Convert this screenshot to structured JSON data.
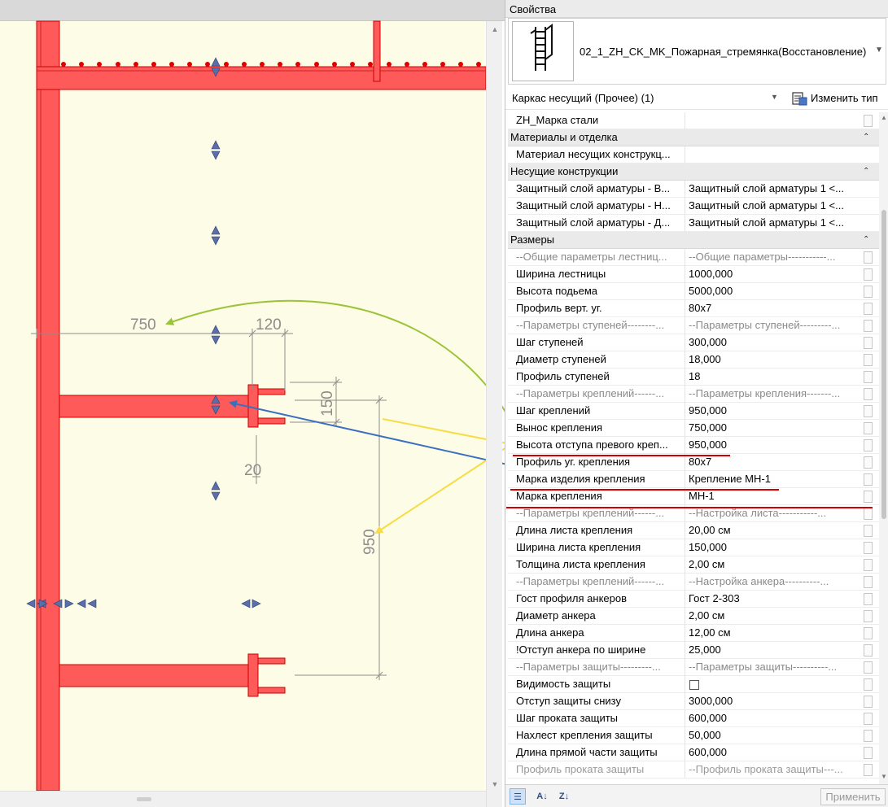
{
  "colors": {
    "canvas_bg": "#fdfce6",
    "steel_fill": "#ff5a5a",
    "steel_edge": "#cc0000",
    "grip": "#5a6ea8",
    "dimension": "#8c8c8c",
    "arrow_green": "#9bc43a",
    "arrow_blue": "#3b6fbf",
    "arrow_yellow": "#f6dc48",
    "underline_red": "#d40000"
  },
  "canvas": {
    "dims": {
      "d750": "750",
      "d120": "120",
      "d150": "150",
      "d20": "20",
      "d950": "950"
    }
  },
  "properties": {
    "header": "Свойства",
    "type_name": "02_1_ZH_CK_MK_Пожарная_стремянка(Восстановление)",
    "category": "Каркас несущий (Прочее) (1)",
    "edit_type_label": "Изменить тип",
    "apply_label": "Применить",
    "rows": [
      {
        "kind": "param",
        "name": "ZH_Марка стали",
        "value": "",
        "check": true
      },
      {
        "kind": "group",
        "name": "Материалы и отделка"
      },
      {
        "kind": "param",
        "name": "Материал несущих конструкц...",
        "value": "",
        "check": false
      },
      {
        "kind": "group",
        "name": "Несущие конструкции"
      },
      {
        "kind": "param",
        "name": "Защитный слой арматуры - В...",
        "value": "Защитный слой арматуры 1 <...",
        "check": false
      },
      {
        "kind": "param",
        "name": "Защитный слой арматуры - Н...",
        "value": "Защитный слой арматуры 1 <...",
        "check": false
      },
      {
        "kind": "param",
        "name": "Защитный слой арматуры - Д...",
        "value": "Защитный слой арматуры 1 <...",
        "check": false
      },
      {
        "kind": "group",
        "name": "Размеры"
      },
      {
        "kind": "sep",
        "name": "--Общие параметры лестниц...",
        "value": "--Общие параметры-----------...",
        "check": true
      },
      {
        "kind": "param",
        "name": "Ширина лестницы",
        "value": "1000,000",
        "check": true
      },
      {
        "kind": "param",
        "name": "Высота подьема",
        "value": "5000,000",
        "check": true
      },
      {
        "kind": "param",
        "name": "Профиль верт. уг.",
        "value": "80x7",
        "check": true
      },
      {
        "kind": "sep",
        "name": "--Параметры ступеней--------...",
        "value": "--Параметры ступеней---------...",
        "check": true
      },
      {
        "kind": "param",
        "name": "Шаг ступеней",
        "value": "300,000",
        "check": true
      },
      {
        "kind": "param",
        "name": "Диаметр ступеней",
        "value": "18,000",
        "check": true
      },
      {
        "kind": "param",
        "name": "Профиль ступеней",
        "value": "18",
        "check": true
      },
      {
        "kind": "sep",
        "name": "--Параметры креплений------...",
        "value": "--Параметры крепления-------...",
        "check": true
      },
      {
        "kind": "param",
        "name": "Шаг креплений",
        "value": "950,000",
        "check": true
      },
      {
        "kind": "param",
        "name": "Вынос крепления",
        "value": "750,000",
        "check": true
      },
      {
        "kind": "param",
        "name": "Высота отступа превого креп...",
        "value": "950,000",
        "check": true
      },
      {
        "kind": "param",
        "name": "Профиль уг. крепления",
        "value": "80x7",
        "check": true
      },
      {
        "kind": "param",
        "name": "Марка изделия крепления",
        "value": "Крепление МН-1",
        "check": true
      },
      {
        "kind": "param",
        "name": "Марка крепления",
        "value": "МН-1",
        "check": true
      },
      {
        "kind": "sep",
        "name": "--Параметры креплений------...",
        "value": "--Настройка листа-----------...",
        "check": true
      },
      {
        "kind": "param",
        "name": "Длина листа крепления",
        "value": "20,00 см",
        "check": true
      },
      {
        "kind": "param",
        "name": "Ширина листа крепления",
        "value": "150,000",
        "check": true
      },
      {
        "kind": "param",
        "name": "Толщина листа крепления",
        "value": "2,00 см",
        "check": true
      },
      {
        "kind": "sep",
        "name": "--Параметры креплений------...",
        "value": "--Настройка анкера----------...",
        "check": true
      },
      {
        "kind": "param",
        "name": "Гост профиля анкеров",
        "value": "Гост 2-303",
        "check": true
      },
      {
        "kind": "param",
        "name": "Диаметр анкера",
        "value": "2,00 см",
        "check": true
      },
      {
        "kind": "param",
        "name": "Длина анкера",
        "value": "12,00 см",
        "check": true
      },
      {
        "kind": "param",
        "name": "!Отступ анкера по ширине",
        "value": "25,000",
        "check": true
      },
      {
        "kind": "sep",
        "name": "--Параметры защиты---------...",
        "value": "--Параметры защиты----------...",
        "check": true
      },
      {
        "kind": "checkbox",
        "name": "Видимость защиты",
        "value": "",
        "check": true
      },
      {
        "kind": "param",
        "name": "Отступ защиты снизу",
        "value": "3000,000",
        "check": true
      },
      {
        "kind": "param",
        "name": "Шаг проката защиты",
        "value": "600,000",
        "check": true
      },
      {
        "kind": "param",
        "name": "Нахлест крепления защиты",
        "value": "50,000",
        "check": true
      },
      {
        "kind": "param",
        "name": "Длина прямой части защиты",
        "value": "600,000",
        "check": true
      },
      {
        "kind": "faded",
        "name": "Профиль проката защиты",
        "value": "--Профиль проката защиты---...",
        "check": true
      }
    ]
  }
}
